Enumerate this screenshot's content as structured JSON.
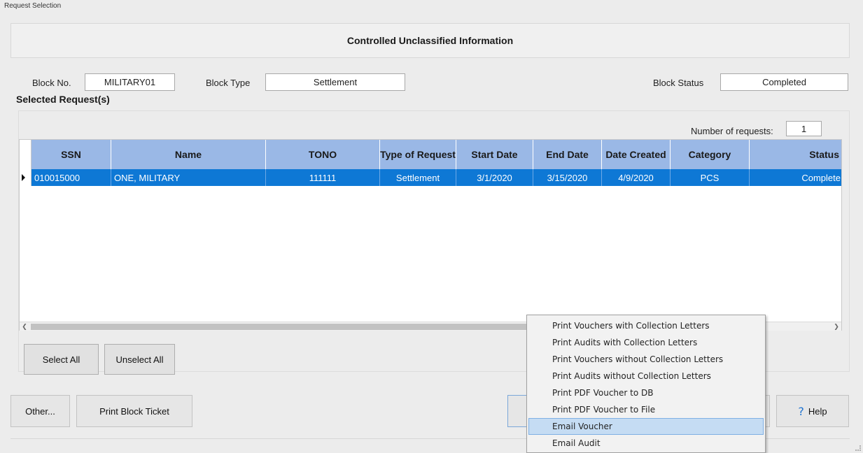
{
  "window": {
    "title": "Request Selection"
  },
  "banner": {
    "text": "Controlled Unclassified Information"
  },
  "block": {
    "no_label": "Block No.",
    "no_value": "MILITARY01",
    "type_label": "Block Type",
    "type_value": "Settlement",
    "status_label": "Block Status",
    "status_value": "Completed"
  },
  "selected": {
    "title": "Selected Request(s)",
    "count_label": "Number of requests:",
    "count_value": "1"
  },
  "grid": {
    "columns": [
      "SSN",
      "Name",
      "TONO",
      "Type of Request",
      "Start Date",
      "End Date",
      "Date Created",
      "Category",
      "Status"
    ],
    "rows": [
      [
        "010015000",
        "ONE, MILITARY",
        "111111",
        "Settlement",
        "3/1/2020",
        "3/15/2020",
        "4/9/2020",
        "PCS",
        "Complete"
      ]
    ]
  },
  "buttons": {
    "select_all": "Select All",
    "unselect_all": "Unselect All",
    "other": "Other...",
    "print_block_ticket": "Print Block Ticket",
    "help": "Help"
  },
  "menu": {
    "items": [
      "Print Vouchers with Collection Letters",
      "Print Audits with Collection Letters",
      "Print Vouchers without Collection Letters",
      "Print Audits without Collection Letters",
      "Print PDF Voucher to DB",
      "Print PDF Voucher to File",
      "Email Voucher",
      "Email Audit"
    ],
    "highlighted": "Email Voucher"
  },
  "icons": {
    "help": "question-mark-icon",
    "row_indicator": "current-row-arrow-icon",
    "scroll_left": "scroll-left-arrow-icon",
    "scroll_right": "scroll-right-arrow-icon"
  },
  "colors": {
    "header": "#9ab8e6",
    "selection": "#0e78d5",
    "menu_highlight": "#c5dcf3"
  }
}
